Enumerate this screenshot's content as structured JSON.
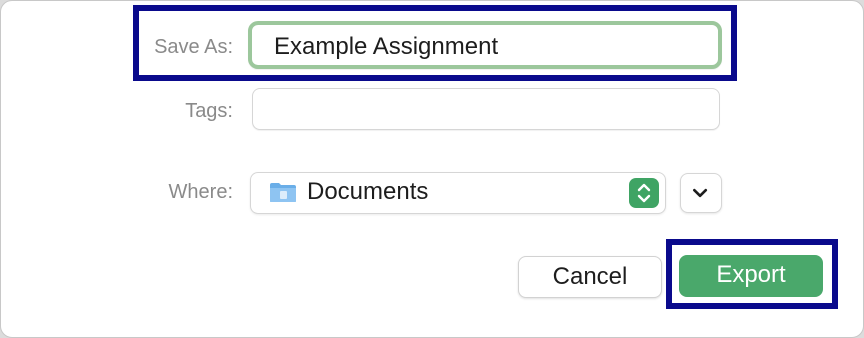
{
  "dialog": {
    "save_as": {
      "label": "Save As:",
      "value": "Example Assignment"
    },
    "tags": {
      "label": "Tags:",
      "value": ""
    },
    "where": {
      "label": "Where:",
      "location": "Documents",
      "folder_icon": "folder-icon",
      "stepper_icon": "up-down-chevron-icon",
      "expand_icon": "chevron-down-icon"
    },
    "buttons": {
      "cancel_label": "Cancel",
      "export_label": "Export"
    }
  },
  "colors": {
    "highlight_border": "#0a0a8c",
    "focus_ring": "#9cc79c",
    "accent_green": "#4aa86b",
    "label_gray": "#8a8a8a"
  }
}
